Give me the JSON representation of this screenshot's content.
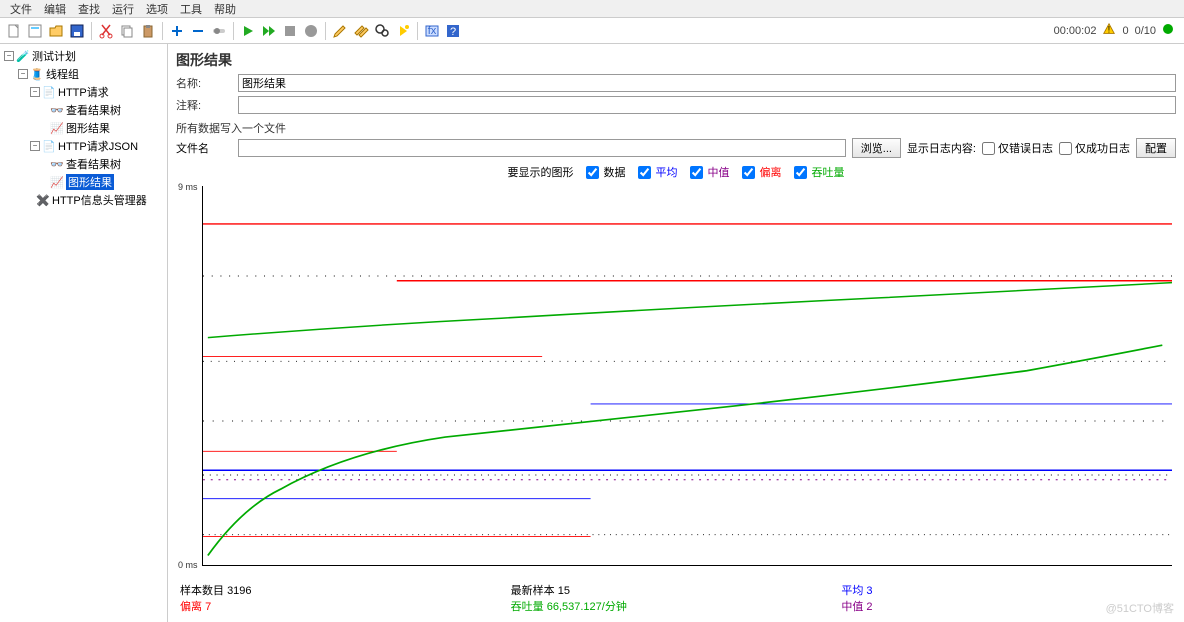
{
  "menu": {
    "file": "文件",
    "edit": "编辑",
    "find": "查找",
    "run": "运行",
    "options": "选项",
    "tools": "工具",
    "help": "帮助"
  },
  "status": {
    "time": "00:00:02",
    "threads": "0/10"
  },
  "tree": {
    "plan": "测试计划",
    "group": "线程组",
    "http1": "HTTP请求",
    "viewtree1": "查看结果树",
    "graph1": "图形结果",
    "httpjson": "HTTP请求JSON",
    "viewtree2": "查看结果树",
    "graph2": "图形结果",
    "headers": "HTTP信息头管理器"
  },
  "panel": {
    "title": "图形结果",
    "name_label": "名称:",
    "name_value": "图形结果",
    "comment_label": "注释:",
    "comment_value": "",
    "write_note": "所有数据写入一个文件",
    "file_label": "文件名",
    "file_value": "",
    "browse": "浏览...",
    "show_log": "显示日志内容:",
    "only_err": "仅错误日志",
    "only_ok": "仅成功日志",
    "config": "配置"
  },
  "legend": {
    "title": "要显示的图形",
    "data": "数据",
    "avg": "平均",
    "median": "中值",
    "dev": "偏离",
    "thr": "吞吐量"
  },
  "axis": {
    "ymax": "9 ms",
    "ymin": "0 ms"
  },
  "stats": {
    "samples_k": "样本数目",
    "samples_v": "3196",
    "dev_k": "偏离",
    "dev_v": "7",
    "latest_k": "最新样本",
    "latest_v": "15",
    "thr_k": "吞吐量",
    "thr_v": "66,537.127/分钟",
    "avg_k": "平均",
    "avg_v": "3",
    "med_k": "中值",
    "med_v": "2"
  },
  "watermark": "@51CTO博客",
  "chart_data": {
    "type": "line",
    "ylim": [
      0,
      9
    ],
    "xlabel": "",
    "ylabel": "ms",
    "series": [
      {
        "name": "数据",
        "color": "#000",
        "style": "scatter"
      },
      {
        "name": "平均",
        "color": "#00f",
        "style": "step"
      },
      {
        "name": "中值",
        "color": "#808",
        "style": "step"
      },
      {
        "name": "偏离",
        "color": "#f00",
        "style": "step"
      },
      {
        "name": "吞吐量",
        "color": "#0a0",
        "style": "line"
      }
    ],
    "avg_levels": [
      2,
      3
    ],
    "median_levels": [
      2
    ],
    "deviation_levels": [
      4,
      5,
      6,
      7,
      8
    ],
    "throughput_curve": [
      [
        0,
        0.5
      ],
      [
        5,
        1.5
      ],
      [
        10,
        2.2
      ],
      [
        20,
        3.0
      ],
      [
        30,
        3.5
      ],
      [
        40,
        4.0
      ],
      [
        50,
        4.3
      ],
      [
        60,
        4.7
      ],
      [
        70,
        5.0
      ],
      [
        80,
        5.3
      ],
      [
        90,
        5.6
      ],
      [
        100,
        5.8
      ]
    ],
    "avg_curve": [
      [
        0,
        5.8
      ],
      [
        20,
        6.2
      ],
      [
        40,
        6.6
      ],
      [
        60,
        6.9
      ],
      [
        80,
        7.1
      ],
      [
        100,
        7.3
      ]
    ]
  }
}
